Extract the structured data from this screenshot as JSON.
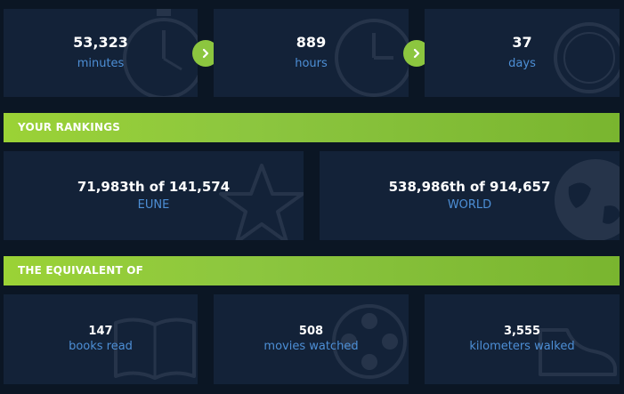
{
  "time": {
    "minutes": {
      "value": "53,323",
      "label": "minutes"
    },
    "hours": {
      "value": "889",
      "label": "hours"
    },
    "days": {
      "value": "37",
      "label": "days"
    }
  },
  "rankings": {
    "header": "YOUR RANKINGS",
    "region": {
      "value": "71,983th of 141,574",
      "label": "EUNE"
    },
    "world": {
      "value": "538,986th of 914,657",
      "label": "WORLD"
    }
  },
  "equivalent": {
    "header": "THE EQUIVALENT OF",
    "books": {
      "value": "147",
      "label": "books read"
    },
    "movies": {
      "value": "508",
      "label": "movies watched"
    },
    "walked": {
      "value": "3,555",
      "label": "kilometers walked"
    }
  },
  "icons": {
    "arrow": "chevron-right-icon",
    "stopwatch": "stopwatch-icon",
    "clock": "clock-icon",
    "star": "star-icon",
    "globe": "globe-icon",
    "book": "book-icon",
    "film_reel": "film-reel-icon",
    "shoe": "shoe-icon"
  },
  "colors": {
    "accent": "#8cc63f",
    "card": "#132238",
    "background": "#0b1624",
    "label": "#4d8fd6"
  }
}
